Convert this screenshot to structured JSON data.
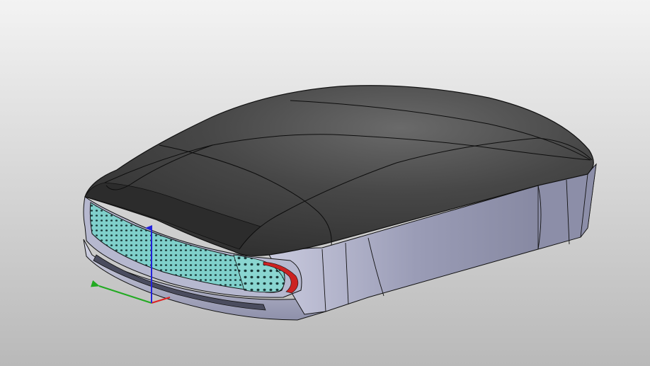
{
  "viewport": {
    "background_top": "#f3f3f3",
    "background_bottom": "#b9b9b9"
  },
  "model": {
    "shell_color": "#3e3e3e",
    "shell_highlight": "#6a6a6a",
    "body_color": "#9a9cb6",
    "body_light": "#c9cade",
    "body_dark": "#74768f",
    "grille_color": "#7fd0cb",
    "edge_color": "#111111",
    "accent_color": "#cc2222"
  },
  "triad": {
    "x_axis_color": "#dd2222",
    "y_axis_color": "#22aa22",
    "z_axis_color": "#2222dd"
  }
}
